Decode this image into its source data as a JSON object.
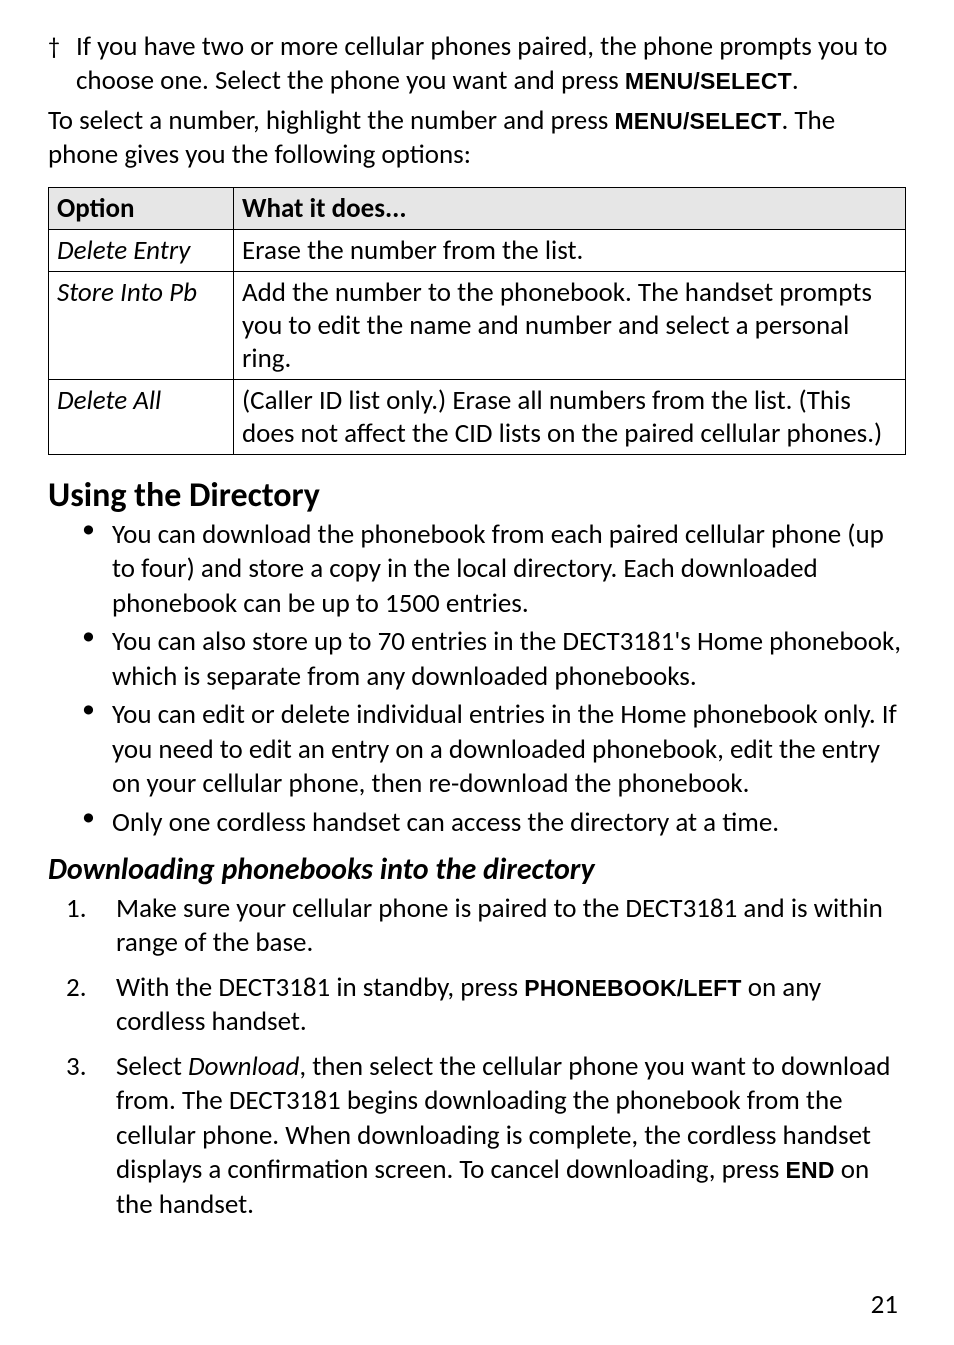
{
  "footnote": {
    "mark": "†",
    "text_before": "If you have two or more cellular phones paired, the phone prompts you to choose one. Select the phone you want and press ",
    "key": "MENU/SELECT",
    "text_after": "."
  },
  "intro": {
    "before": "To select a number, highlight the number and press ",
    "key": "MENU/SELECT",
    "after": ". The phone gives you the following options:"
  },
  "table": {
    "headers": {
      "option": "Option",
      "what": "What it does..."
    },
    "rows": [
      {
        "option": "Delete Entry",
        "what": "Erase the number from the list."
      },
      {
        "option": "Store Into Pb",
        "what": "Add the number to the phonebook. The handset prompts you to edit the name and number and select a personal ring."
      },
      {
        "option": "Delete All",
        "what": "(Caller ID list only.) Erase all numbers from the list. (This does not affect the CID lists on the paired cellular phones.)"
      }
    ]
  },
  "section_title": "Using the Directory",
  "bullets": [
    "You can download the phonebook from each paired cellular phone (up to four) and store a copy in the local directory. Each downloaded phonebook can be up to 1500 entries.",
    "You can also store up to 70 entries in the DECT3181's Home phonebook, which is separate from any downloaded phonebooks.",
    "You can edit or delete individual entries in the Home phonebook only. If you need to edit an entry on a downloaded phonebook, edit the entry on your cellular phone, then re-download the phonebook.",
    "Only one cordless handset can access the directory at a time."
  ],
  "subsection_title": "Downloading phonebooks into the directory",
  "steps": {
    "s1": "Make sure your cellular phone is paired to the DECT3181 and is within range of the base.",
    "s2_before": "With the DECT3181 in standby, press ",
    "s2_key": "PHONEBOOK/LEFT",
    "s2_after": " on any cordless handset.",
    "s3_a": "Select ",
    "s3_ital": "Download",
    "s3_b": ", then select the cellular phone you want to download from. The DECT3181 begins downloading the phonebook from the cellular phone. When downloading is complete, the cordless handset displays a confirmation screen. To cancel downloading, press ",
    "s3_key": "END",
    "s3_c": " on the handset."
  },
  "page_number": "21"
}
